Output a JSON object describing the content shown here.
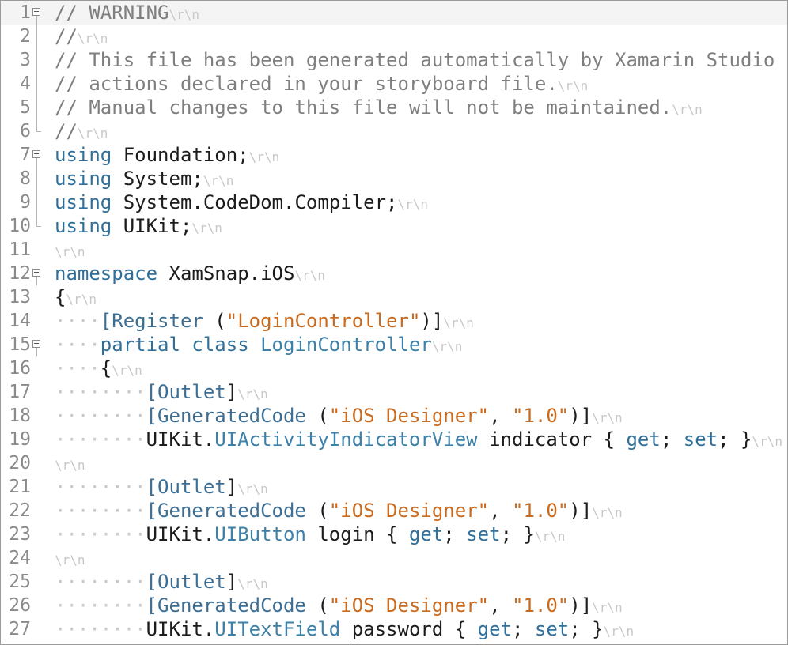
{
  "editor": {
    "current_line": 1,
    "lines": [
      {
        "n": "1",
        "fold": "start",
        "tokens": [
          {
            "k": "comment",
            "t": "// WARNING"
          },
          {
            "k": "eol",
            "t": "\\r\\n"
          }
        ]
      },
      {
        "n": "2",
        "fold": "mid",
        "tokens": [
          {
            "k": "comment",
            "t": "//"
          },
          {
            "k": "eol",
            "t": "\\r\\n"
          }
        ]
      },
      {
        "n": "3",
        "fold": "mid",
        "tokens": [
          {
            "k": "comment",
            "t": "// This file has been generated automatically by Xamarin Studio to store outlets and"
          }
        ]
      },
      {
        "n": "4",
        "fold": "mid",
        "tokens": [
          {
            "k": "comment",
            "t": "// actions declared in your storyboard file."
          },
          {
            "k": "eol",
            "t": "\\r\\n"
          }
        ]
      },
      {
        "n": "5",
        "fold": "mid",
        "tokens": [
          {
            "k": "comment",
            "t": "// Manual changes to this file will not be maintained."
          },
          {
            "k": "eol",
            "t": "\\r\\n"
          }
        ]
      },
      {
        "n": "6",
        "fold": "end",
        "tokens": [
          {
            "k": "comment",
            "t": "//"
          },
          {
            "k": "eol",
            "t": "\\r\\n"
          }
        ]
      },
      {
        "n": "7",
        "fold": "start",
        "tokens": [
          {
            "k": "kw",
            "t": "using"
          },
          {
            "k": "plain",
            "t": " Foundation;"
          },
          {
            "k": "eol",
            "t": "\\r\\n"
          }
        ]
      },
      {
        "n": "8",
        "fold": "mid",
        "tokens": [
          {
            "k": "kw",
            "t": "using"
          },
          {
            "k": "plain",
            "t": " System;"
          },
          {
            "k": "eol",
            "t": "\\r\\n"
          }
        ]
      },
      {
        "n": "9",
        "fold": "mid",
        "tokens": [
          {
            "k": "kw",
            "t": "using"
          },
          {
            "k": "plain",
            "t": " System.CodeDom.Compiler;"
          },
          {
            "k": "eol",
            "t": "\\r\\n"
          }
        ]
      },
      {
        "n": "10",
        "fold": "end",
        "tokens": [
          {
            "k": "kw",
            "t": "using"
          },
          {
            "k": "plain",
            "t": " UIKit;"
          },
          {
            "k": "eol",
            "t": "\\r\\n"
          }
        ]
      },
      {
        "n": "11",
        "fold": "",
        "tokens": [
          {
            "k": "eol",
            "t": "\\r\\n"
          }
        ]
      },
      {
        "n": "12",
        "fold": "start",
        "tokens": [
          {
            "k": "kw",
            "t": "namespace"
          },
          {
            "k": "plain",
            "t": " XamSnap.iOS"
          },
          {
            "k": "eol",
            "t": "\\r\\n"
          }
        ]
      },
      {
        "n": "13",
        "fold": "",
        "tokens": [
          {
            "k": "plain",
            "t": "{"
          },
          {
            "k": "eol",
            "t": "\\r\\n"
          }
        ]
      },
      {
        "n": "14",
        "fold": "",
        "tokens": [
          {
            "k": "ws",
            "t": "····"
          },
          {
            "k": "attr",
            "t": "[Register"
          },
          {
            "k": "plain",
            "t": " ("
          },
          {
            "k": "str",
            "t": "\"LoginController\""
          },
          {
            "k": "plain",
            "t": ")]"
          },
          {
            "k": "eol",
            "t": "\\r\\n"
          }
        ]
      },
      {
        "n": "15",
        "fold": "start",
        "tokens": [
          {
            "k": "ws",
            "t": "····"
          },
          {
            "k": "kw",
            "t": "partial"
          },
          {
            "k": "plain",
            "t": " "
          },
          {
            "k": "kw",
            "t": "class"
          },
          {
            "k": "plain",
            "t": " "
          },
          {
            "k": "type",
            "t": "LoginController"
          },
          {
            "k": "eol",
            "t": "\\r\\n"
          }
        ]
      },
      {
        "n": "16",
        "fold": "",
        "tokens": [
          {
            "k": "ws",
            "t": "····"
          },
          {
            "k": "plain",
            "t": "{"
          },
          {
            "k": "eol",
            "t": "\\r\\n"
          }
        ]
      },
      {
        "n": "17",
        "fold": "",
        "tokens": [
          {
            "k": "ws",
            "t": "········"
          },
          {
            "k": "attr",
            "t": "[Outlet"
          },
          {
            "k": "plain",
            "t": "]"
          },
          {
            "k": "eol",
            "t": "\\r\\n"
          }
        ]
      },
      {
        "n": "18",
        "fold": "",
        "tokens": [
          {
            "k": "ws",
            "t": "········"
          },
          {
            "k": "attr",
            "t": "[GeneratedCode"
          },
          {
            "k": "plain",
            "t": " ("
          },
          {
            "k": "str",
            "t": "\"iOS Designer\""
          },
          {
            "k": "plain",
            "t": ", "
          },
          {
            "k": "str",
            "t": "\"1.0\""
          },
          {
            "k": "plain",
            "t": ")]"
          },
          {
            "k": "eol",
            "t": "\\r\\n"
          }
        ]
      },
      {
        "n": "19",
        "fold": "",
        "tokens": [
          {
            "k": "ws",
            "t": "········"
          },
          {
            "k": "plain",
            "t": "UIKit."
          },
          {
            "k": "type",
            "t": "UIActivityIndicatorView"
          },
          {
            "k": "plain",
            "t": " indicator { "
          },
          {
            "k": "kw",
            "t": "get"
          },
          {
            "k": "plain",
            "t": "; "
          },
          {
            "k": "kw",
            "t": "set"
          },
          {
            "k": "plain",
            "t": "; }"
          },
          {
            "k": "eol",
            "t": "\\r\\n"
          }
        ]
      },
      {
        "n": "20",
        "fold": "",
        "tokens": [
          {
            "k": "eol",
            "t": "\\r\\n"
          }
        ]
      },
      {
        "n": "21",
        "fold": "",
        "tokens": [
          {
            "k": "ws",
            "t": "········"
          },
          {
            "k": "attr",
            "t": "[Outlet"
          },
          {
            "k": "plain",
            "t": "]"
          },
          {
            "k": "eol",
            "t": "\\r\\n"
          }
        ]
      },
      {
        "n": "22",
        "fold": "",
        "tokens": [
          {
            "k": "ws",
            "t": "········"
          },
          {
            "k": "attr",
            "t": "[GeneratedCode"
          },
          {
            "k": "plain",
            "t": " ("
          },
          {
            "k": "str",
            "t": "\"iOS Designer\""
          },
          {
            "k": "plain",
            "t": ", "
          },
          {
            "k": "str",
            "t": "\"1.0\""
          },
          {
            "k": "plain",
            "t": ")]"
          },
          {
            "k": "eol",
            "t": "\\r\\n"
          }
        ]
      },
      {
        "n": "23",
        "fold": "",
        "tokens": [
          {
            "k": "ws",
            "t": "········"
          },
          {
            "k": "plain",
            "t": "UIKit."
          },
          {
            "k": "type",
            "t": "UIButton"
          },
          {
            "k": "plain",
            "t": " login { "
          },
          {
            "k": "kw",
            "t": "get"
          },
          {
            "k": "plain",
            "t": "; "
          },
          {
            "k": "kw",
            "t": "set"
          },
          {
            "k": "plain",
            "t": "; }"
          },
          {
            "k": "eol",
            "t": "\\r\\n"
          }
        ]
      },
      {
        "n": "24",
        "fold": "",
        "tokens": [
          {
            "k": "eol",
            "t": "\\r\\n"
          }
        ]
      },
      {
        "n": "25",
        "fold": "",
        "tokens": [
          {
            "k": "ws",
            "t": "········"
          },
          {
            "k": "attr",
            "t": "[Outlet"
          },
          {
            "k": "plain",
            "t": "]"
          },
          {
            "k": "eol",
            "t": "\\r\\n"
          }
        ]
      },
      {
        "n": "26",
        "fold": "",
        "tokens": [
          {
            "k": "ws",
            "t": "········"
          },
          {
            "k": "attr",
            "t": "[GeneratedCode"
          },
          {
            "k": "plain",
            "t": " ("
          },
          {
            "k": "str",
            "t": "\"iOS Designer\""
          },
          {
            "k": "plain",
            "t": ", "
          },
          {
            "k": "str",
            "t": "\"1.0\""
          },
          {
            "k": "plain",
            "t": ")]"
          },
          {
            "k": "eol",
            "t": "\\r\\n"
          }
        ]
      },
      {
        "n": "27",
        "fold": "",
        "tokens": [
          {
            "k": "ws",
            "t": "········"
          },
          {
            "k": "plain",
            "t": "UIKit."
          },
          {
            "k": "type",
            "t": "UITextField"
          },
          {
            "k": "plain",
            "t": " password { "
          },
          {
            "k": "kw",
            "t": "get"
          },
          {
            "k": "plain",
            "t": "; "
          },
          {
            "k": "kw",
            "t": "set"
          },
          {
            "k": "plain",
            "t": "; }"
          },
          {
            "k": "eol",
            "t": "\\r\\n"
          }
        ]
      }
    ]
  }
}
